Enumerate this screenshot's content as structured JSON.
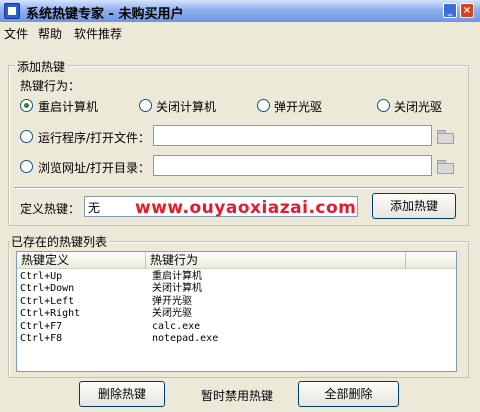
{
  "window": {
    "title": "系统热键专家 - 未购买用户",
    "minimize_glyph": "_",
    "close_glyph": "×"
  },
  "menu": [
    "文件",
    "帮助",
    "软件推荐"
  ],
  "add_hotkey": {
    "group_title": "添加热键",
    "behavior_label": "热键行为：",
    "options": [
      {
        "label": "重启计算机",
        "checked": true
      },
      {
        "label": "关闭计算机",
        "checked": false
      },
      {
        "label": "弹开光驱",
        "checked": false
      },
      {
        "label": "关闭光驱",
        "checked": false
      }
    ],
    "run_program_label": "运行程序/打开文件：",
    "run_program_value": "",
    "browse_label": "浏览网址/打开目录：",
    "browse_value": "",
    "define_label": "定义热键：",
    "define_value": "无",
    "add_button": "添加热键"
  },
  "watermark": "www.ouyaoxiazai.com",
  "existing": {
    "group_title": "已存在的热键列表",
    "columns": [
      "热键定义",
      "热键行为"
    ],
    "rows": [
      {
        "key": "Ctrl+Up",
        "action": "重启计算机"
      },
      {
        "key": "Ctrl+Down",
        "action": "关闭计算机"
      },
      {
        "key": "Ctrl+Left",
        "action": "弹开光驱"
      },
      {
        "key": "Ctrl+Right",
        "action": "关闭光驱"
      },
      {
        "key": "Ctrl+F7",
        "action": "calc.exe"
      },
      {
        "key": "Ctrl+F8",
        "action": "notepad.exe"
      }
    ]
  },
  "bottom": {
    "delete_button": "删除热键",
    "disable_label": "暂时禁用热键",
    "delete_all_button": "全部删除"
  },
  "colors": {
    "window_bg": "#ECE9D8",
    "titlebar": "#6f94e2",
    "watermark": "#e8192a",
    "radio_dot": "#1f8a1f"
  }
}
